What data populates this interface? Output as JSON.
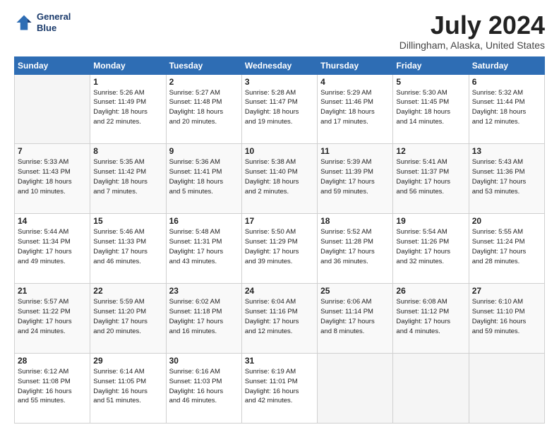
{
  "header": {
    "logo_line1": "General",
    "logo_line2": "Blue",
    "month": "July 2024",
    "location": "Dillingham, Alaska, United States"
  },
  "weekdays": [
    "Sunday",
    "Monday",
    "Tuesday",
    "Wednesday",
    "Thursday",
    "Friday",
    "Saturday"
  ],
  "weeks": [
    [
      {
        "day": "",
        "content": ""
      },
      {
        "day": "1",
        "content": "Sunrise: 5:26 AM\nSunset: 11:49 PM\nDaylight: 18 hours\nand 22 minutes."
      },
      {
        "day": "2",
        "content": "Sunrise: 5:27 AM\nSunset: 11:48 PM\nDaylight: 18 hours\nand 20 minutes."
      },
      {
        "day": "3",
        "content": "Sunrise: 5:28 AM\nSunset: 11:47 PM\nDaylight: 18 hours\nand 19 minutes."
      },
      {
        "day": "4",
        "content": "Sunrise: 5:29 AM\nSunset: 11:46 PM\nDaylight: 18 hours\nand 17 minutes."
      },
      {
        "day": "5",
        "content": "Sunrise: 5:30 AM\nSunset: 11:45 PM\nDaylight: 18 hours\nand 14 minutes."
      },
      {
        "day": "6",
        "content": "Sunrise: 5:32 AM\nSunset: 11:44 PM\nDaylight: 18 hours\nand 12 minutes."
      }
    ],
    [
      {
        "day": "7",
        "content": "Sunrise: 5:33 AM\nSunset: 11:43 PM\nDaylight: 18 hours\nand 10 minutes."
      },
      {
        "day": "8",
        "content": "Sunrise: 5:35 AM\nSunset: 11:42 PM\nDaylight: 18 hours\nand 7 minutes."
      },
      {
        "day": "9",
        "content": "Sunrise: 5:36 AM\nSunset: 11:41 PM\nDaylight: 18 hours\nand 5 minutes."
      },
      {
        "day": "10",
        "content": "Sunrise: 5:38 AM\nSunset: 11:40 PM\nDaylight: 18 hours\nand 2 minutes."
      },
      {
        "day": "11",
        "content": "Sunrise: 5:39 AM\nSunset: 11:39 PM\nDaylight: 17 hours\nand 59 minutes."
      },
      {
        "day": "12",
        "content": "Sunrise: 5:41 AM\nSunset: 11:37 PM\nDaylight: 17 hours\nand 56 minutes."
      },
      {
        "day": "13",
        "content": "Sunrise: 5:43 AM\nSunset: 11:36 PM\nDaylight: 17 hours\nand 53 minutes."
      }
    ],
    [
      {
        "day": "14",
        "content": "Sunrise: 5:44 AM\nSunset: 11:34 PM\nDaylight: 17 hours\nand 49 minutes."
      },
      {
        "day": "15",
        "content": "Sunrise: 5:46 AM\nSunset: 11:33 PM\nDaylight: 17 hours\nand 46 minutes."
      },
      {
        "day": "16",
        "content": "Sunrise: 5:48 AM\nSunset: 11:31 PM\nDaylight: 17 hours\nand 43 minutes."
      },
      {
        "day": "17",
        "content": "Sunrise: 5:50 AM\nSunset: 11:29 PM\nDaylight: 17 hours\nand 39 minutes."
      },
      {
        "day": "18",
        "content": "Sunrise: 5:52 AM\nSunset: 11:28 PM\nDaylight: 17 hours\nand 36 minutes."
      },
      {
        "day": "19",
        "content": "Sunrise: 5:54 AM\nSunset: 11:26 PM\nDaylight: 17 hours\nand 32 minutes."
      },
      {
        "day": "20",
        "content": "Sunrise: 5:55 AM\nSunset: 11:24 PM\nDaylight: 17 hours\nand 28 minutes."
      }
    ],
    [
      {
        "day": "21",
        "content": "Sunrise: 5:57 AM\nSunset: 11:22 PM\nDaylight: 17 hours\nand 24 minutes."
      },
      {
        "day": "22",
        "content": "Sunrise: 5:59 AM\nSunset: 11:20 PM\nDaylight: 17 hours\nand 20 minutes."
      },
      {
        "day": "23",
        "content": "Sunrise: 6:02 AM\nSunset: 11:18 PM\nDaylight: 17 hours\nand 16 minutes."
      },
      {
        "day": "24",
        "content": "Sunrise: 6:04 AM\nSunset: 11:16 PM\nDaylight: 17 hours\nand 12 minutes."
      },
      {
        "day": "25",
        "content": "Sunrise: 6:06 AM\nSunset: 11:14 PM\nDaylight: 17 hours\nand 8 minutes."
      },
      {
        "day": "26",
        "content": "Sunrise: 6:08 AM\nSunset: 11:12 PM\nDaylight: 17 hours\nand 4 minutes."
      },
      {
        "day": "27",
        "content": "Sunrise: 6:10 AM\nSunset: 11:10 PM\nDaylight: 16 hours\nand 59 minutes."
      }
    ],
    [
      {
        "day": "28",
        "content": "Sunrise: 6:12 AM\nSunset: 11:08 PM\nDaylight: 16 hours\nand 55 minutes."
      },
      {
        "day": "29",
        "content": "Sunrise: 6:14 AM\nSunset: 11:05 PM\nDaylight: 16 hours\nand 51 minutes."
      },
      {
        "day": "30",
        "content": "Sunrise: 6:16 AM\nSunset: 11:03 PM\nDaylight: 16 hours\nand 46 minutes."
      },
      {
        "day": "31",
        "content": "Sunrise: 6:19 AM\nSunset: 11:01 PM\nDaylight: 16 hours\nand 42 minutes."
      },
      {
        "day": "",
        "content": ""
      },
      {
        "day": "",
        "content": ""
      },
      {
        "day": "",
        "content": ""
      }
    ]
  ]
}
